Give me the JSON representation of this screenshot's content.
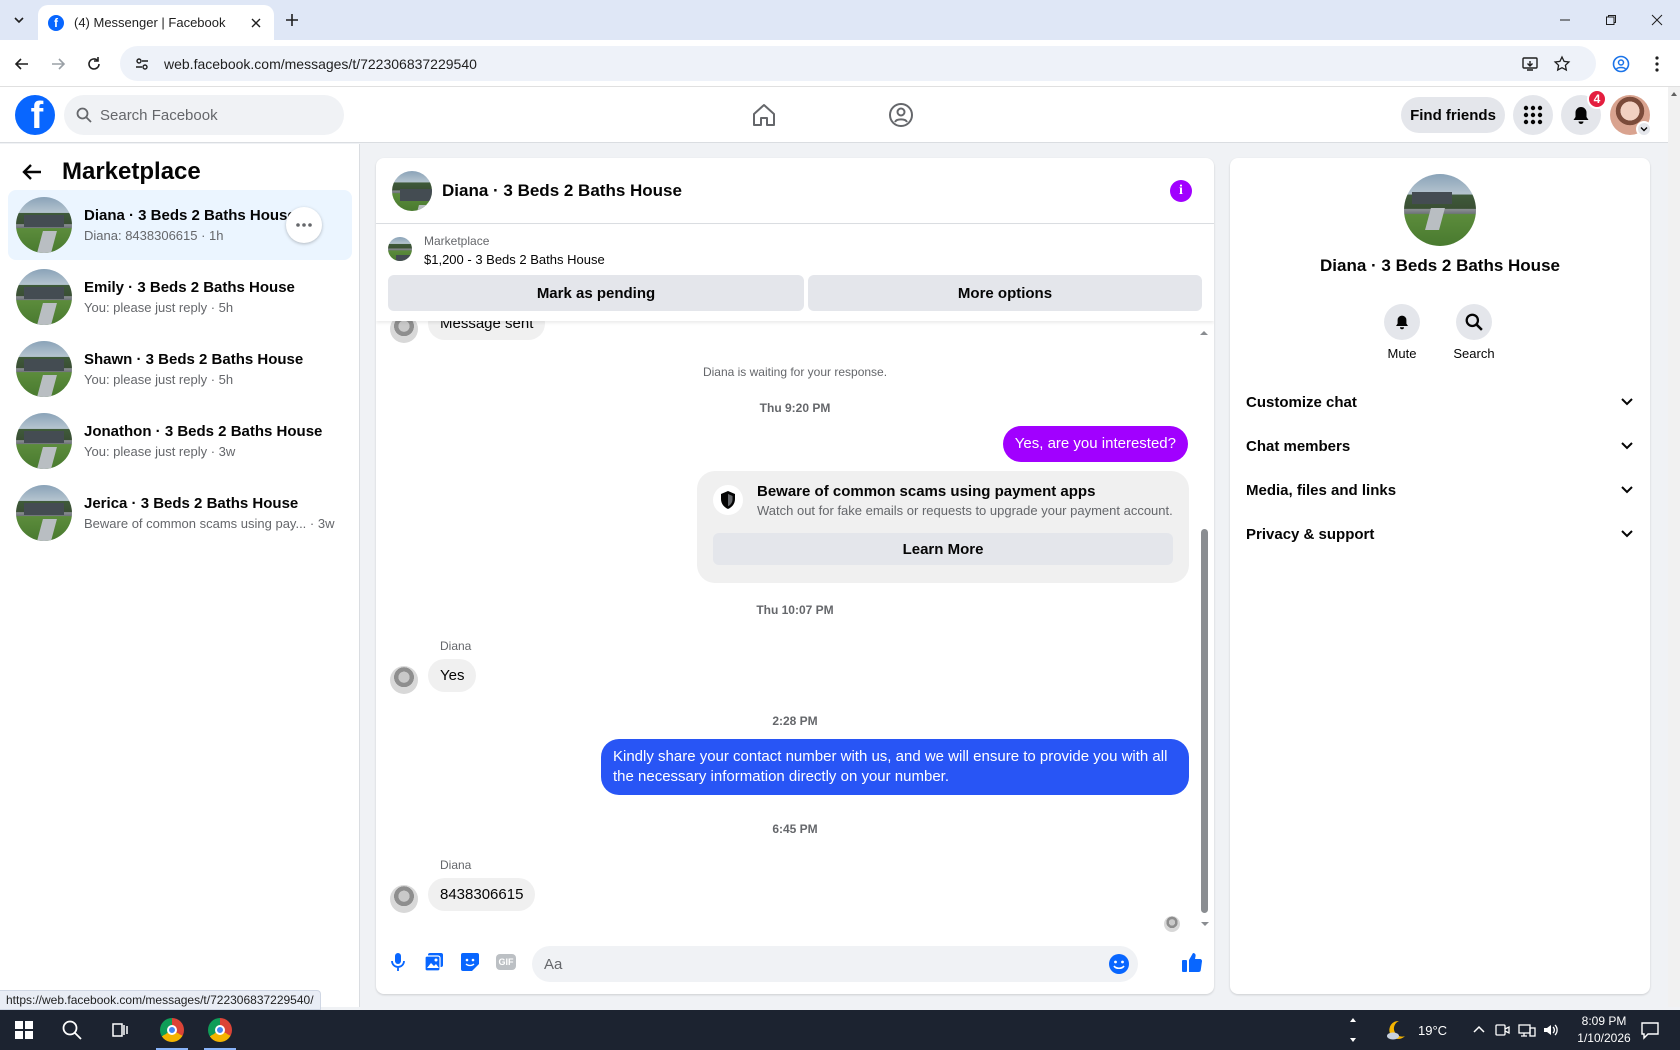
{
  "browser": {
    "tab_title": "(4) Messenger | Facebook",
    "url": "web.facebook.com/messages/t/722306837229540",
    "status_url": "https://web.facebook.com/messages/t/722306837229540/"
  },
  "fb_header": {
    "search_placeholder": "Search Facebook",
    "find_friends": "Find friends",
    "notification_count": "4"
  },
  "left_panel": {
    "title": "Marketplace",
    "chats": [
      {
        "name": "Diana · 3 Beds 2 Baths House",
        "preview": "Diana: 8438306615 · 1h"
      },
      {
        "name": "Emily · 3 Beds 2 Baths House",
        "preview": "You: please just reply · 5h"
      },
      {
        "name": "Shawn · 3 Beds 2 Baths House",
        "preview": "You: please just reply · 5h"
      },
      {
        "name": "Jonathon · 3 Beds 2 Baths House",
        "preview": "You: please just reply · 3w"
      },
      {
        "name": "Jerica · 3 Beds 2 Baths House",
        "preview": "Beware of common scams using pay... · 3w"
      }
    ]
  },
  "conversation": {
    "title": "Diana · 3 Beds 2 Baths House",
    "marketplace_label": "Marketplace",
    "listing": "$1,200 - 3 Beds 2 Baths House",
    "mark_pending": "Mark as pending",
    "more_options": "More options",
    "partial_message": "Message sent",
    "waiting_text": "Diana is waiting for your response.",
    "ts1": "Thu 9:20 PM",
    "out1": "Yes, are you interested?",
    "scam_title": "Beware of common scams using payment apps",
    "scam_body": "Watch out for fake emails or requests to upgrade your payment account.",
    "learn_more": "Learn More",
    "ts2": "Thu 10:07 PM",
    "sender1": "Diana",
    "in1": "Yes",
    "ts3": "2:28 PM",
    "out2": "Kindly share your contact number with us, and we will ensure to provide you with all the necessary information directly on your number.",
    "ts4": "6:45 PM",
    "sender2": "Diana",
    "in2": "8438306615",
    "composer_placeholder": "Aa",
    "gif_label": "GIF"
  },
  "right_panel": {
    "name": "Diana · 3 Beds 2 Baths House",
    "mute": "Mute",
    "search": "Search",
    "sections": [
      "Customize chat",
      "Chat members",
      "Media, files and links",
      "Privacy & support"
    ]
  },
  "taskbar": {
    "temperature": "19°C",
    "time": "8:09 PM",
    "date": "1/10/2026"
  },
  "colors": {
    "fb_blue": "#0866ff",
    "bubble_purple": "#a100ff",
    "bubble_blue": "#2855f5"
  }
}
